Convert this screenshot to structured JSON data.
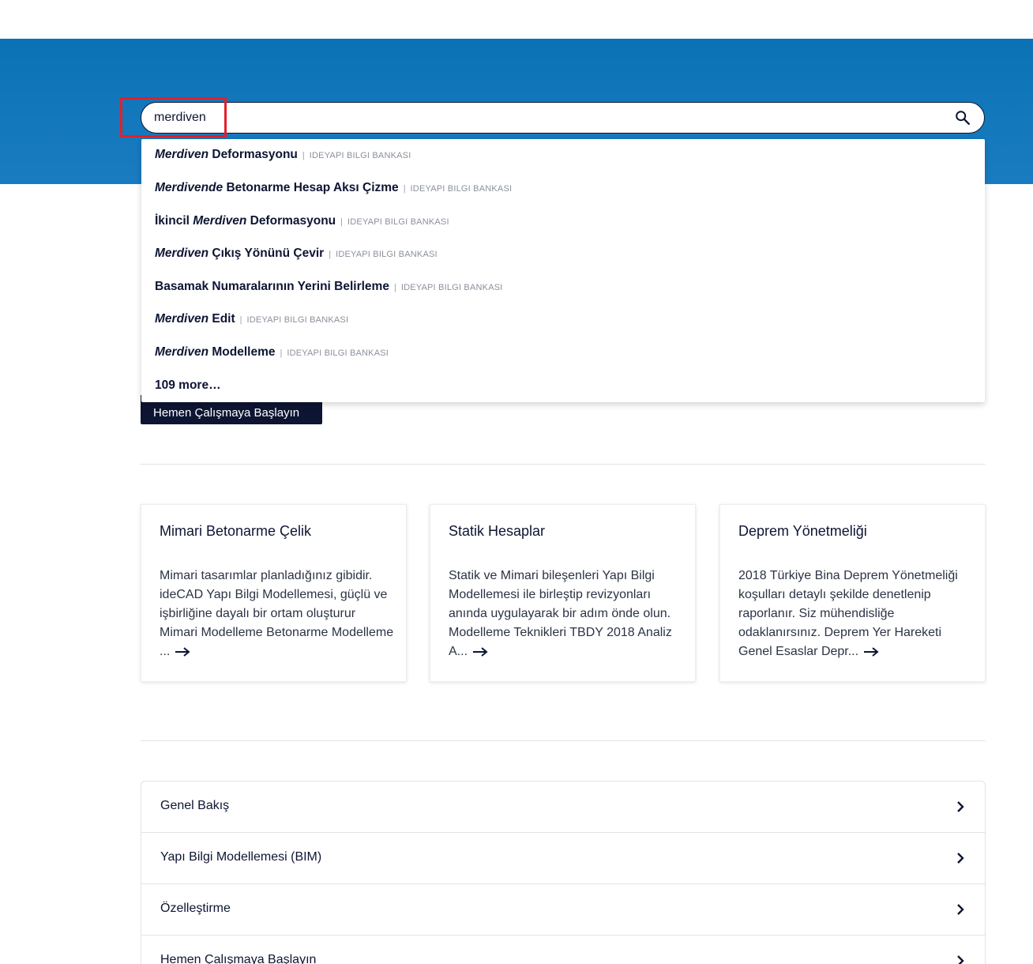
{
  "search": {
    "value": "merdiven",
    "suggestions": [
      {
        "em": "Merdiven",
        "rest": " Deformasyonu",
        "source": "IDEYAPI BILGI BANKASI"
      },
      {
        "em": "Merdivende",
        "rest": " Betonarme Hesap Aksı Çizme",
        "source": "IDEYAPI BILGI BANKASI"
      },
      {
        "pre": "İkincil ",
        "em": "Merdiven",
        "rest": " Deformasyonu",
        "source": "IDEYAPI BILGI BANKASI"
      },
      {
        "em": "Merdiven",
        "rest": " Çıkış Yönünü Çevir",
        "source": "IDEYAPI BILGI BANKASI"
      },
      {
        "rest": "Basamak Numaralarının Yerini Belirleme",
        "source": "IDEYAPI BILGI BANKASI"
      },
      {
        "em": "Merdiven",
        "rest": " Edit",
        "source": "IDEYAPI BILGI BANKASI"
      },
      {
        "em": "Merdiven",
        "rest": " Modelleme",
        "source": "IDEYAPI BILGI BANKASI"
      }
    ],
    "more_label": "109 more…",
    "separator": "|"
  },
  "cta": {
    "label": "Hemen Çalışmaya Başlayın"
  },
  "cards": [
    {
      "title": "Mimari Betonarme Çelik",
      "text": "Mimari tasarımlar planladığınız gibidir. ideCAD Yapı Bilgi Modellemesi, güçlü ve işbirliğine dayalı bir ortam oluşturur Mimari Modelleme Betonarme Modelleme ..."
    },
    {
      "title": "Statik Hesaplar",
      "text": "Statik ve Mimari bileşenleri Yapı Bilgi Modellemesi ile birleştip revizyonları anında uygulayarak bir adım önde olun. Modelleme Teknikleri TBDY 2018 Analiz A..."
    },
    {
      "title": "Deprem Yönetmeliği",
      "text": "2018 Türkiye Bina Deprem Yönetmeliği koşulları detaylı şekilde denetlenip raporlanır. Siz mühendisliğe odaklanırsınız. Deprem Yer Hareketi Genel Esaslar Depr..."
    }
  ],
  "accordion": [
    {
      "label": "Genel Bakış"
    },
    {
      "label": "Yapı Bilgi Modellemesi (BIM)"
    },
    {
      "label": "Özelleştirme"
    },
    {
      "label": "Hemen Çalışmaya Başlayın"
    }
  ],
  "icons": {
    "search": "search-icon",
    "arrow": "arrow-right-icon",
    "chevron": "chevron-right-icon"
  },
  "colors": {
    "brand_blue": "#0b72b6",
    "navy": "#0d1533",
    "highlight": "#e3202a"
  }
}
